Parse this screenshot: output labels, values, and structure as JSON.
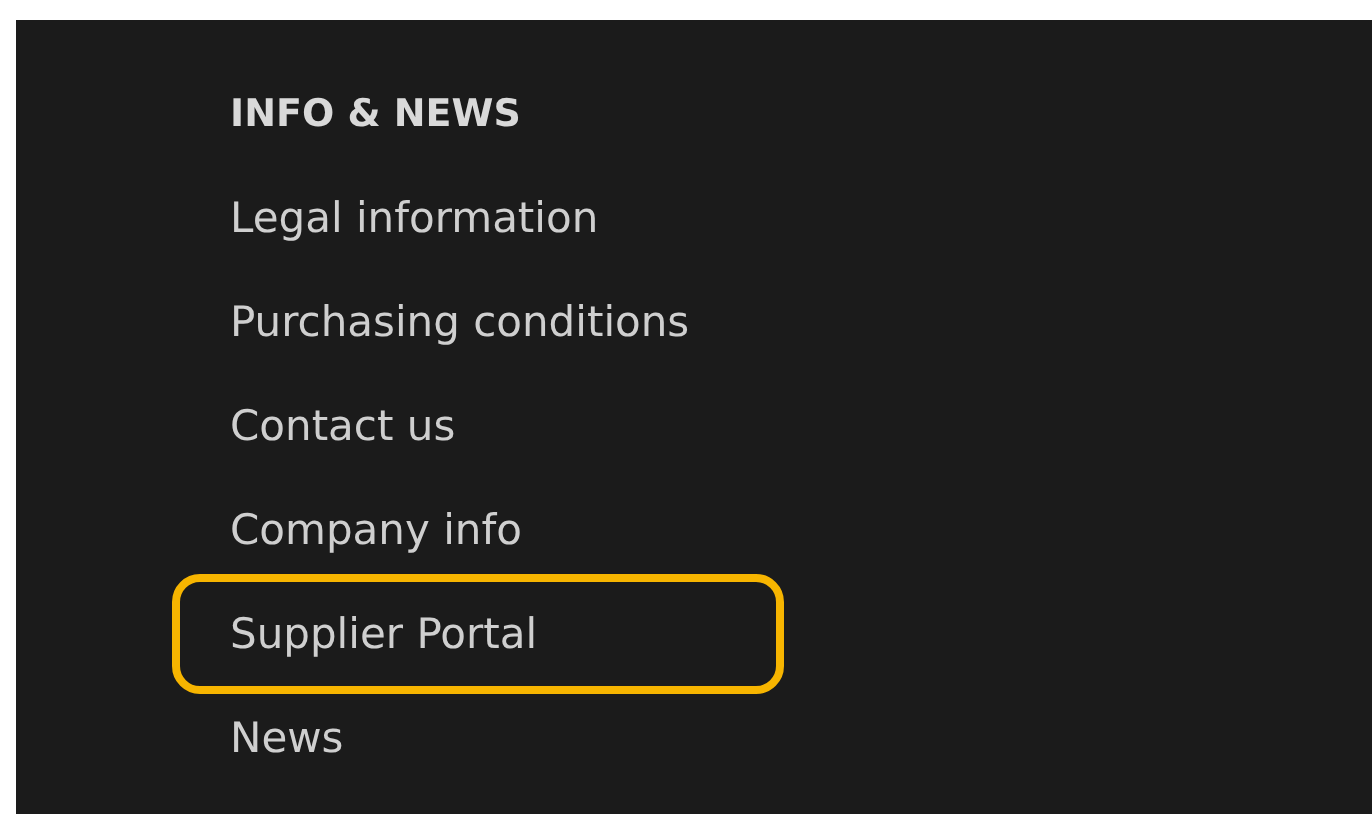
{
  "footer_section": {
    "heading": "INFO & NEWS",
    "links": [
      {
        "label": "Legal information",
        "highlighted": false
      },
      {
        "label": "Purchasing conditions",
        "highlighted": false
      },
      {
        "label": "Contact us",
        "highlighted": false
      },
      {
        "label": "Company info",
        "highlighted": false
      },
      {
        "label": "Supplier Portal",
        "highlighted": true
      },
      {
        "label": "News",
        "highlighted": false
      }
    ]
  }
}
